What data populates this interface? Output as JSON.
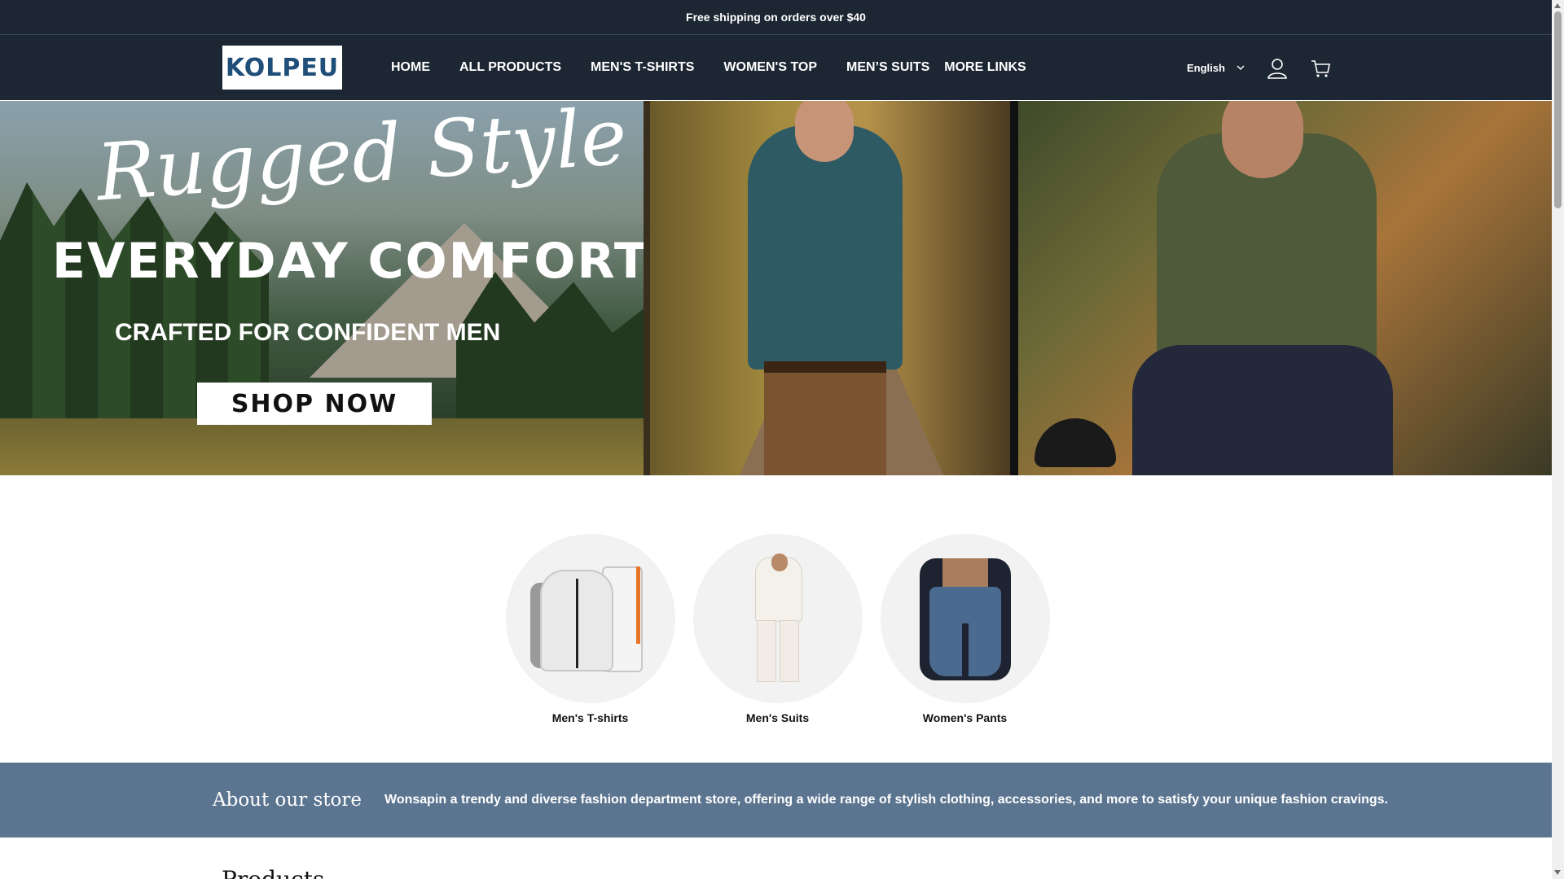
{
  "announcement": {
    "text": "Free shipping on orders over $40"
  },
  "header": {
    "logo_text": "KOLPEU",
    "nav": [
      {
        "label": "HOME"
      },
      {
        "label": "ALL PRODUCTS"
      },
      {
        "label": "MEN'S T-SHIRTS"
      },
      {
        "label": "WOMEN'S TOP"
      },
      {
        "label": "MEN’S SUITS"
      },
      {
        "label": "MORE LINKS"
      }
    ],
    "language": "English",
    "icons": {
      "account": "user-icon",
      "cart": "cart-icon",
      "language_toggle": "chevron-down-icon"
    }
  },
  "hero": {
    "script_text": "Rugged Style",
    "headline": "EVERYDAY COMFORT",
    "subline": "CRAFTED FOR CONFIDENT MEN",
    "cta": "SHOP NOW"
  },
  "categories": [
    {
      "label": "Men's T-shirts"
    },
    {
      "label": "Men's Suits"
    },
    {
      "label": "Women's Pants"
    }
  ],
  "about": {
    "title": "About our store",
    "text": "Wonsapin a trendy and diverse fashion department store, offering a wide range of stylish clothing, accessories, and more to satisfy your unique fashion cravings."
  },
  "products": {
    "title": "Products"
  },
  "colors": {
    "header_bg": "#1c2733",
    "about_bg": "#5b7590",
    "logo_text": "#1f4e79",
    "accent_orange": "#e8742a"
  }
}
